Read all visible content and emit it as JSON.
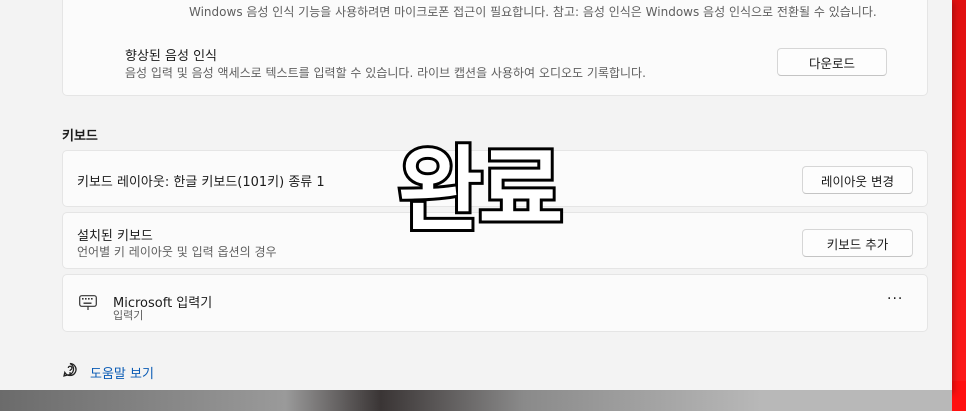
{
  "top_card": {
    "cut_text": "Windows 음성 인식 기능을 사용하려면 마이크로폰 접근이 필요합니다. 참고: 음성 인식은 Windows 음성 인식으로 전환될 수 있습니다.",
    "title": "향상된 음성 인식",
    "subtitle": "음성 입력 및 음성 액세스로 텍스트를 입력할 수 있습니다. 라이브 캡션을 사용하여 오디오도 기록합니다.",
    "button": "다운로드"
  },
  "keyboard_section": {
    "label": "키보드",
    "layout_row": {
      "title": "키보드 레이아웃: 한글 키보드(101키) 종류 1",
      "button": "레이아웃 변경"
    },
    "installed_row": {
      "title": "설치된 키보드",
      "subtitle": "언어별 키 레이아웃 및 입력 옵션의 경우",
      "button": "키보드 추가"
    },
    "ime_row": {
      "title": "Microsoft 입력기",
      "subtitle": "입력기",
      "more": "···",
      "icon": "keyboard-icon"
    }
  },
  "help": {
    "label": "도움말 보기",
    "icon": "help-icon"
  },
  "overlay_text": "완료",
  "colors": {
    "link": "#0a5bb5",
    "accent_red": "#ff1a1a"
  }
}
